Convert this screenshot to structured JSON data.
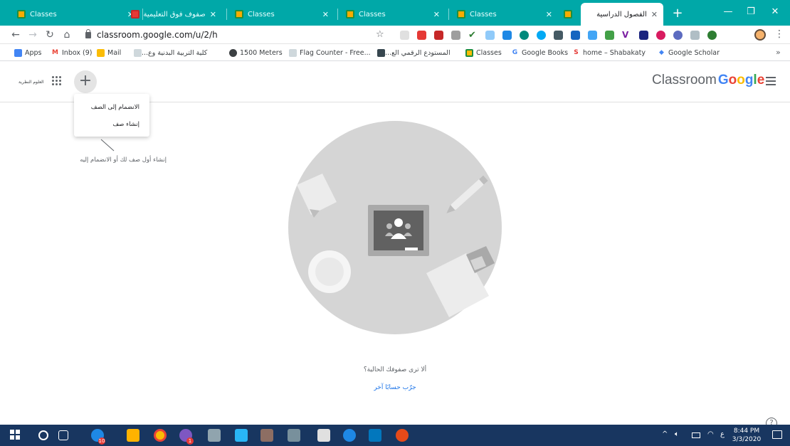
{
  "browser": {
    "tabs": [
      {
        "title": "Classes"
      },
      {
        "title": "صفوف فوق التعليمية"
      },
      {
        "title": "Classes"
      },
      {
        "title": "Classes"
      },
      {
        "title": "Classes"
      },
      {
        "title": ""
      },
      {
        "title": "الفصول الدراسية"
      }
    ],
    "url": "classroom.google.com/u/2/h",
    "bookmarks": [
      {
        "label": "Apps"
      },
      {
        "label": "Inbox (9)"
      },
      {
        "label": "Mail"
      },
      {
        "label": "كلية التربية البدنية وع..."
      },
      {
        "label": "1500 Meters"
      },
      {
        "label": "Flag Counter - Free..."
      },
      {
        "label": "المستودع الرقمي الع..."
      },
      {
        "label": "Classes"
      },
      {
        "label": "Google Books"
      },
      {
        "label": "home – Shabakaty"
      },
      {
        "label": "Google Scholar"
      }
    ]
  },
  "header": {
    "account_label": "العلوم النظرية",
    "add_symbol": "+",
    "brand_prefix": "Classroom",
    "brand_google": [
      "G",
      "o",
      "o",
      "g",
      "l",
      "e"
    ]
  },
  "menu": {
    "join_class": "الانضمام إلى الصف",
    "create_class": "إنشاء صف"
  },
  "main": {
    "hint": "إنشاء أول صف لك أو الانضمام إليه",
    "empty_message": "ألا ترى صفوفك الحالية؟",
    "switch_account": "جرّب حسابًا آخر"
  },
  "taskbar": {
    "badge_a": "10",
    "badge_b": "1",
    "time": "8:44 PM",
    "date": "3/3/2020",
    "lang": "ع"
  },
  "colors": {
    "tabstrip": "#00a8a8",
    "google_blue": "#4285f4",
    "google_red": "#ea4335",
    "google_yellow": "#fbbc05",
    "google_green": "#34a853",
    "taskbar": "#183660"
  }
}
